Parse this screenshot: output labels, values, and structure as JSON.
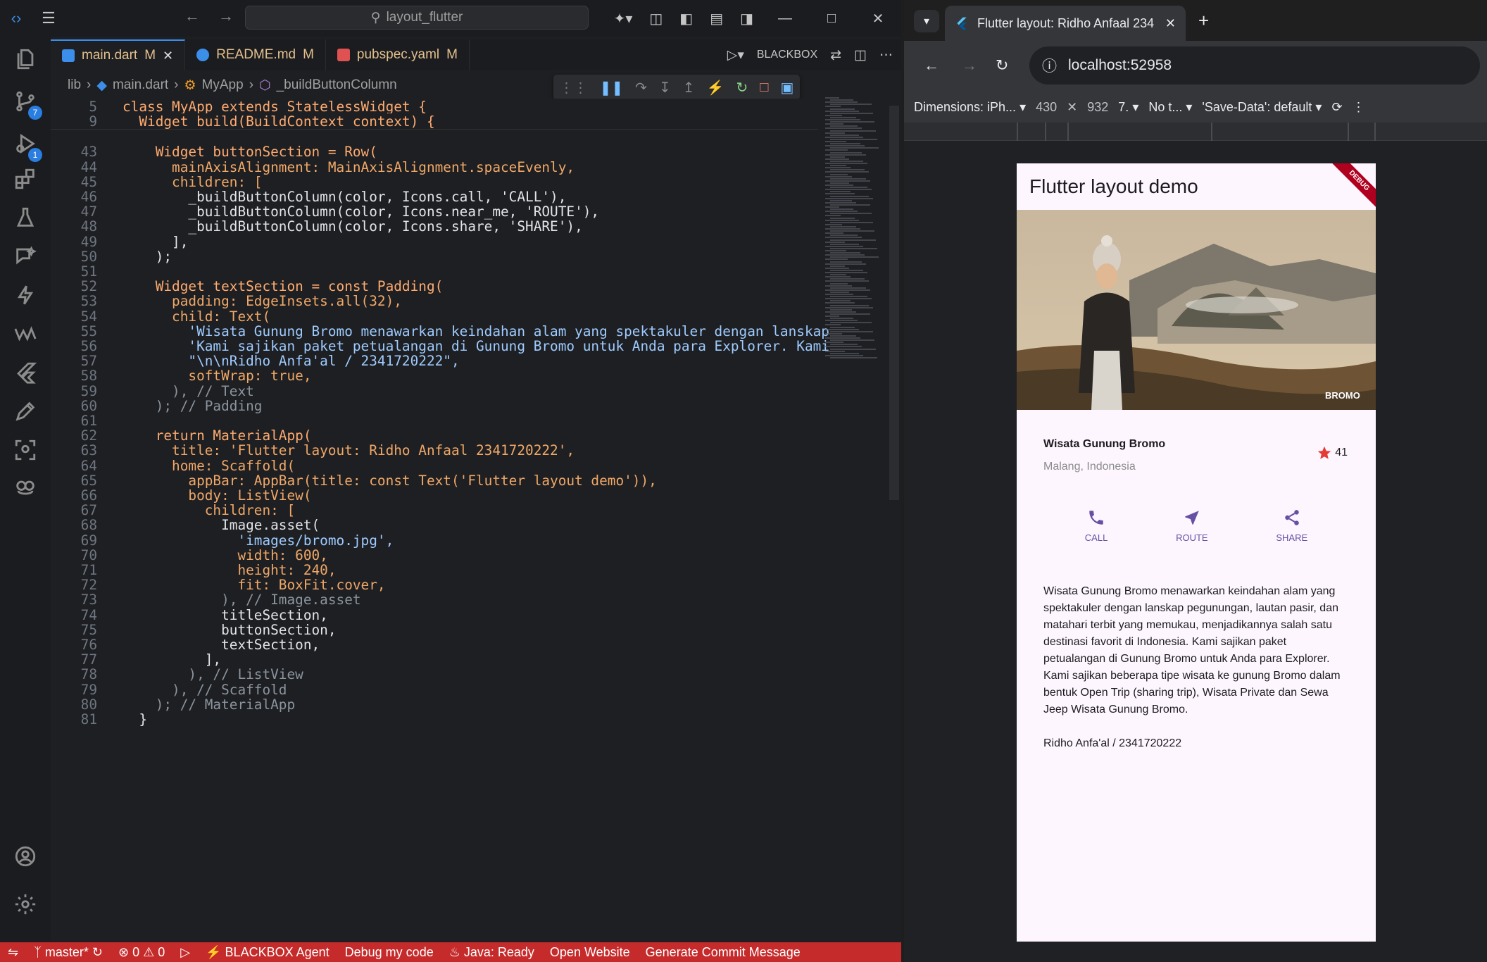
{
  "vscode": {
    "search": "layout_flutter",
    "tabs": [
      {
        "label": "main.dart",
        "status": "M",
        "color": "#e2c08d"
      },
      {
        "label": "README.md",
        "status": "M",
        "color": "#e2c08d"
      },
      {
        "label": "pubspec.yaml",
        "status": "M",
        "color": "#e2c08d"
      }
    ],
    "blackbox": "BLACKBOX",
    "breadcrumb": [
      "lib",
      "main.dart",
      "MyApp",
      "_buildButtonColumn"
    ],
    "badges": {
      "scm": "7",
      "debug": "1"
    },
    "code_lines": [
      {
        "n": "5",
        "text": "class MyApp extends StatelessWidget {"
      },
      {
        "n": "9",
        "text": "  Widget build(BuildContext context) {"
      },
      {
        "n": "43",
        "text": "    Widget buttonSection = Row("
      },
      {
        "n": "44",
        "text": "      mainAxisAlignment: MainAxisAlignment.spaceEvenly,"
      },
      {
        "n": "45",
        "text": "      children: ["
      },
      {
        "n": "46",
        "text": "        _buildButtonColumn(color, Icons.call, 'CALL'),"
      },
      {
        "n": "47",
        "text": "        _buildButtonColumn(color, Icons.near_me, 'ROUTE'),"
      },
      {
        "n": "48",
        "text": "        _buildButtonColumn(color, Icons.share, 'SHARE'),"
      },
      {
        "n": "49",
        "text": "      ],"
      },
      {
        "n": "50",
        "text": "    );"
      },
      {
        "n": "51",
        "text": ""
      },
      {
        "n": "52",
        "text": "    Widget textSection = const Padding("
      },
      {
        "n": "53",
        "text": "      padding: EdgeInsets.all(32),"
      },
      {
        "n": "54",
        "text": "      child: Text("
      },
      {
        "n": "55",
        "text": "        'Wisata Gunung Bromo menawarkan keindahan alam yang spektakuler dengan lanskap"
      },
      {
        "n": "56",
        "text": "        'Kami sajikan paket petualangan di Gunung Bromo untuk Anda para Explorer. Kami"
      },
      {
        "n": "57",
        "text": "        \"\\n\\nRidho Anfa'al / 2341720222\","
      },
      {
        "n": "58",
        "text": "        softWrap: true,"
      },
      {
        "n": "59",
        "text": "      ), // Text"
      },
      {
        "n": "60",
        "text": "    ); // Padding"
      },
      {
        "n": "61",
        "text": ""
      },
      {
        "n": "62",
        "text": "    return MaterialApp("
      },
      {
        "n": "63",
        "text": "      title: 'Flutter layout: Ridho Anfaal 2341720222',"
      },
      {
        "n": "64",
        "text": "      home: Scaffold("
      },
      {
        "n": "65",
        "text": "        appBar: AppBar(title: const Text('Flutter layout demo')),"
      },
      {
        "n": "66",
        "text": "        body: ListView("
      },
      {
        "n": "67",
        "text": "          children: ["
      },
      {
        "n": "68",
        "text": "            Image.asset("
      },
      {
        "n": "69",
        "text": "              'images/bromo.jpg',"
      },
      {
        "n": "70",
        "text": "              width: 600,"
      },
      {
        "n": "71",
        "text": "              height: 240,"
      },
      {
        "n": "72",
        "text": "              fit: BoxFit.cover,"
      },
      {
        "n": "73",
        "text": "            ), // Image.asset"
      },
      {
        "n": "74",
        "text": "            titleSection,"
      },
      {
        "n": "75",
        "text": "            buttonSection,"
      },
      {
        "n": "76",
        "text": "            textSection,"
      },
      {
        "n": "77",
        "text": "          ],"
      },
      {
        "n": "78",
        "text": "        ), // ListView"
      },
      {
        "n": "79",
        "text": "      ), // Scaffold"
      },
      {
        "n": "80",
        "text": "    ); // MaterialApp"
      },
      {
        "n": "81",
        "text": "  }"
      }
    ],
    "status": {
      "branch": "master*",
      "problems": "0",
      "warnings": "0",
      "blackbox_agent": "BLACKBOX Agent",
      "debug_code": "Debug my code",
      "java": "Java: Ready",
      "open_website": "Open Website",
      "commit_msg": "Generate Commit Message"
    },
    "colors": {
      "status_bar": "#c62b2b",
      "accent": "#3b8eea"
    }
  },
  "browser": {
    "tab_title": "Flutter layout: Ridho Anfaal 234",
    "url": "localhost:52958",
    "devtools": {
      "dimensions": "Dimensions: iPh...",
      "width": "430",
      "height": "932",
      "zoom": "7.",
      "throttle": "No t...",
      "save_data": "'Save-Data': default"
    }
  },
  "app": {
    "appbar_title": "Flutter layout demo",
    "debug_banner": "DEBUG",
    "image_label": "BROMO",
    "place_title": "Wisata Gunung Bromo",
    "place_location": "Malang, Indonesia",
    "rating": "41",
    "buttons": [
      {
        "label": "CALL",
        "icon": "call-icon"
      },
      {
        "label": "ROUTE",
        "icon": "near-me-icon"
      },
      {
        "label": "SHARE",
        "icon": "share-icon"
      }
    ],
    "description": "Wisata Gunung Bromo menawarkan keindahan alam yang spektakuler dengan lanskap pegunungan, lautan pasir, dan matahari terbit yang memukau, menjadikannya salah satu destinasi favorit di Indonesia. Kami sajikan paket petualangan di Gunung Bromo untuk Anda para Explorer. Kami sajikan beberapa tipe wisata ke gunung Bromo dalam bentuk Open Trip (sharing trip), Wisata Private dan Sewa Jeep Wisata Gunung Bromo.",
    "signature": "Ridho Anfa'al / 2341720222",
    "colors": {
      "primary": "#6750a4",
      "star": "#e53935",
      "background": "#fdf6fe"
    }
  }
}
